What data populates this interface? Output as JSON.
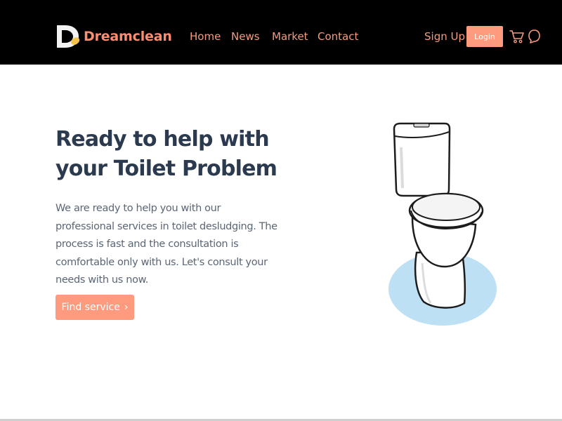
{
  "brand": {
    "name": "Dreamclean",
    "logo_icon": "dreamclean-logo-icon",
    "accent_color": "#fa8e72"
  },
  "nav": {
    "links": [
      "Home",
      "News",
      "Market",
      "Contact"
    ],
    "signup": "Sign Up",
    "login": "Login",
    "icons": [
      "cart-icon",
      "chat-bubble-icon"
    ],
    "background": "#000000"
  },
  "hero": {
    "title": "Ready to help with your Toilet Problem",
    "description": "We are ready to help you with our professional services in toilet desludging. The process is fast and the consultation is comfortable only with us. Let's consult your needs with us now.",
    "cta_label": "Find service",
    "cta_icon": "chevron-right-icon",
    "image": "toilet-illustration"
  },
  "colors": {
    "button": "#fe9a7d",
    "title": "#2b3a4f",
    "text": "#5b6675",
    "image_backdrop": "#bde0f5"
  }
}
